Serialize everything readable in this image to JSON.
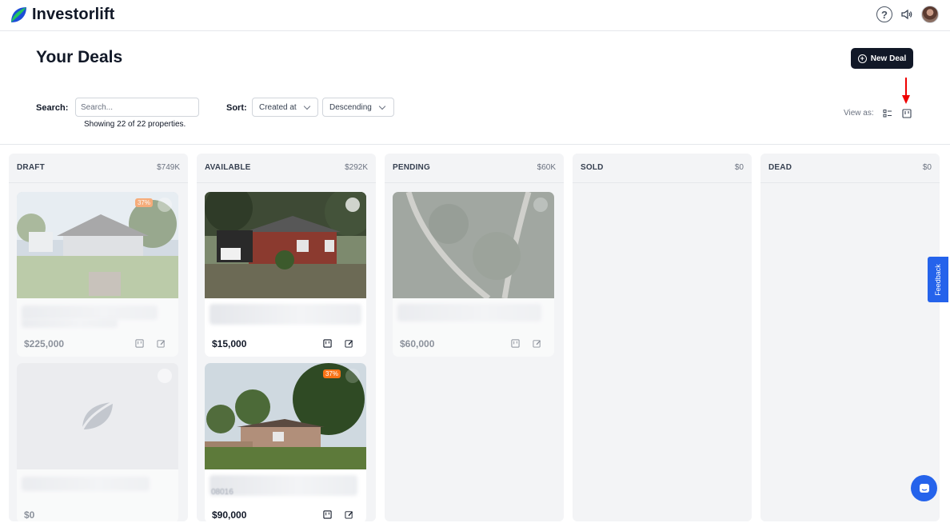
{
  "app": {
    "name": "Investorlift",
    "brand_color": "#2563eb"
  },
  "header": {
    "help_icon": "question-circle-icon",
    "sound_icon": "speaker-icon",
    "avatar": "user-avatar"
  },
  "page": {
    "title": "Your Deals",
    "new_deal_label": "New Deal"
  },
  "filters": {
    "search_label": "Search:",
    "search_placeholder": "Search...",
    "showing_text": "Showing 22 of 22 properties.",
    "sort_label": "Sort:",
    "sort_field": "Created at",
    "sort_order": "Descending",
    "view_as_label": "View as:"
  },
  "columns": [
    {
      "name": "DRAFT",
      "total": "$749K"
    },
    {
      "name": "AVAILABLE",
      "total": "$292K"
    },
    {
      "name": "PENDING",
      "total": "$60K"
    },
    {
      "name": "SOLD",
      "total": "$0"
    },
    {
      "name": "DEAD",
      "total": "$0"
    }
  ],
  "cards": {
    "draft_1": {
      "price": "$225,000",
      "badge": "37%"
    },
    "draft_2": {
      "price": "$0"
    },
    "available_1": {
      "price": "$15,000"
    },
    "available_2": {
      "price": "$90,000",
      "badge": "37%",
      "blurred_code": "08016"
    },
    "pending_1": {
      "price": "$60,000"
    }
  },
  "feedback_label": "Feedback"
}
